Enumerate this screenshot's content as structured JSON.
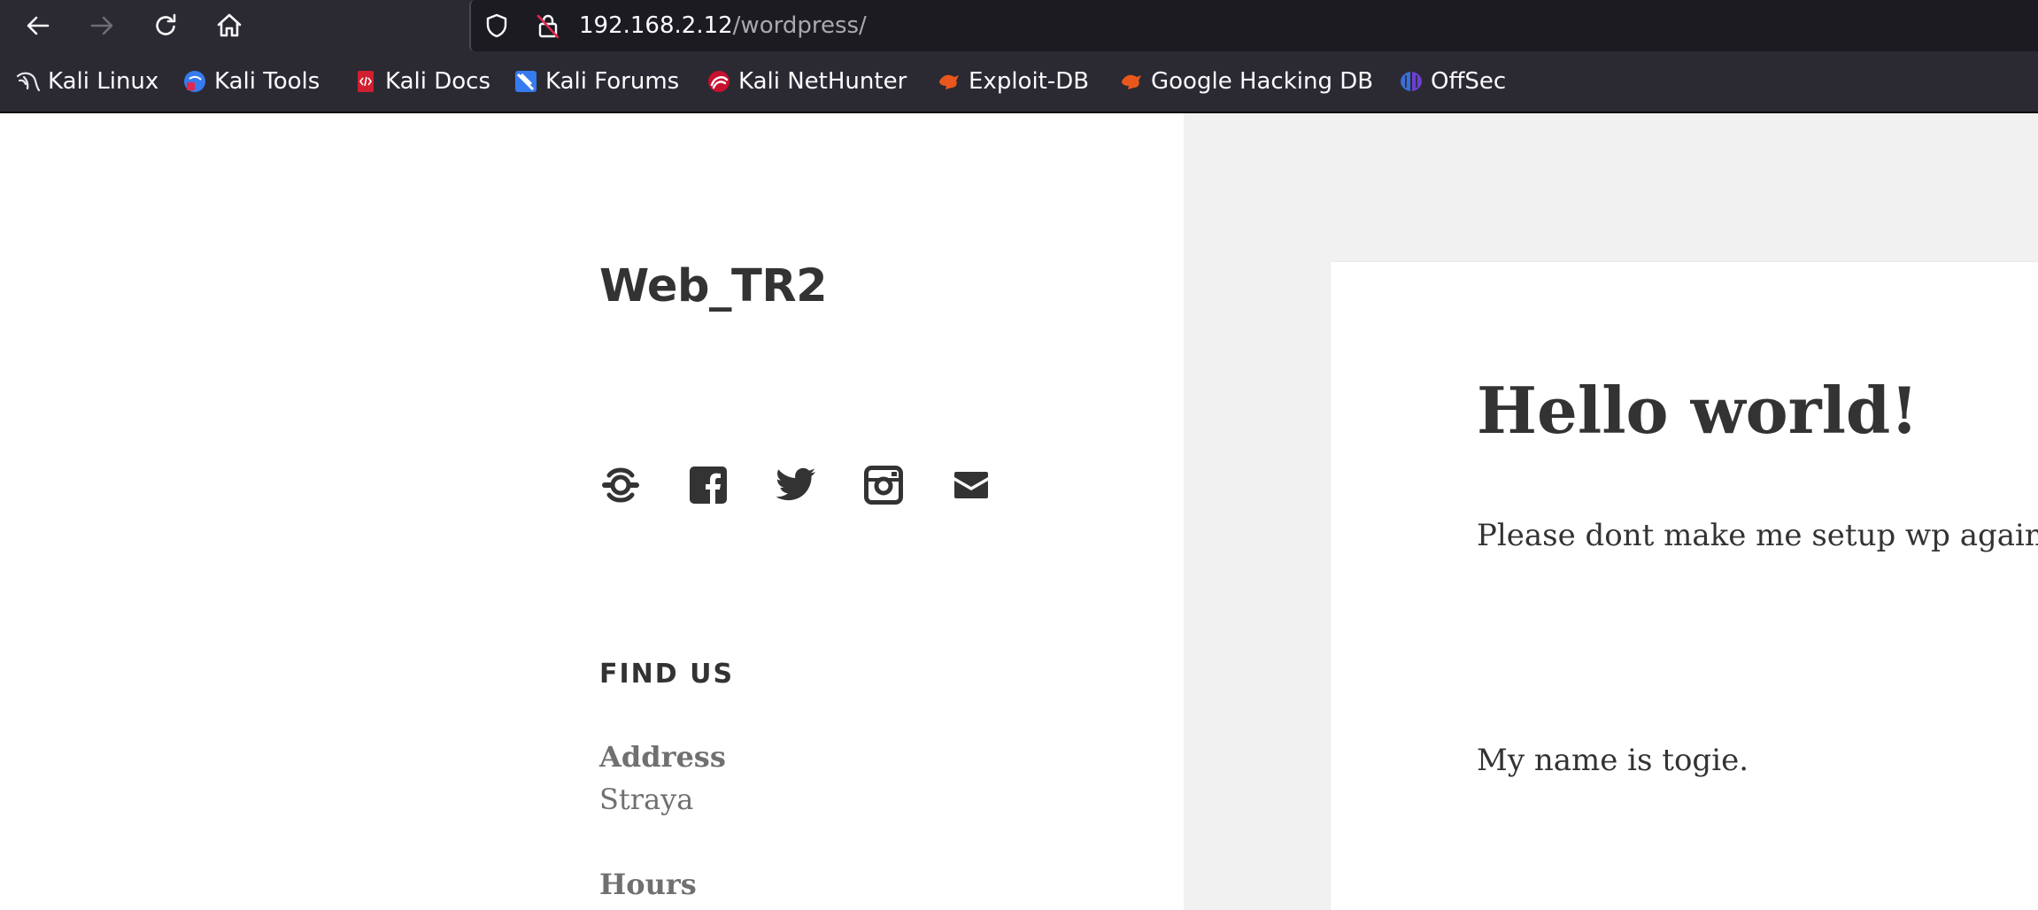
{
  "browser": {
    "url_host": "192.168.2.12",
    "url_path": "/wordpress/",
    "bookmarks": [
      {
        "label": "Kali Linux",
        "icon": "kali-dragon-icon"
      },
      {
        "label": "Kali Tools",
        "icon": "kali-tools-icon"
      },
      {
        "label": "Kali Docs",
        "icon": "kali-docs-icon"
      },
      {
        "label": "Kali Forums",
        "icon": "kali-forums-icon"
      },
      {
        "label": "Kali NetHunter",
        "icon": "kali-nethunter-icon"
      },
      {
        "label": "Exploit-DB",
        "icon": "exploit-db-icon"
      },
      {
        "label": "Google Hacking DB",
        "icon": "google-hacking-db-icon"
      },
      {
        "label": "OffSec",
        "icon": "offsec-icon"
      }
    ]
  },
  "site": {
    "title": "Web_TR2",
    "social_icons": [
      "yelp-icon",
      "facebook-icon",
      "twitter-icon",
      "instagram-icon",
      "email-icon"
    ]
  },
  "widget": {
    "title": "FIND US",
    "address_label": "Address",
    "address_value": "Straya",
    "hours_label": "Hours"
  },
  "post": {
    "title": "Hello world!",
    "paragraph1": "Please dont make me setup wp again",
    "paragraph2": "My name is togie."
  },
  "colors": {
    "chrome_bg": "#2b2a33",
    "urlbar_bg": "#1c1b22",
    "page_text": "#333333",
    "muted_text": "#707070",
    "main_bg": "#f1f1f1"
  }
}
